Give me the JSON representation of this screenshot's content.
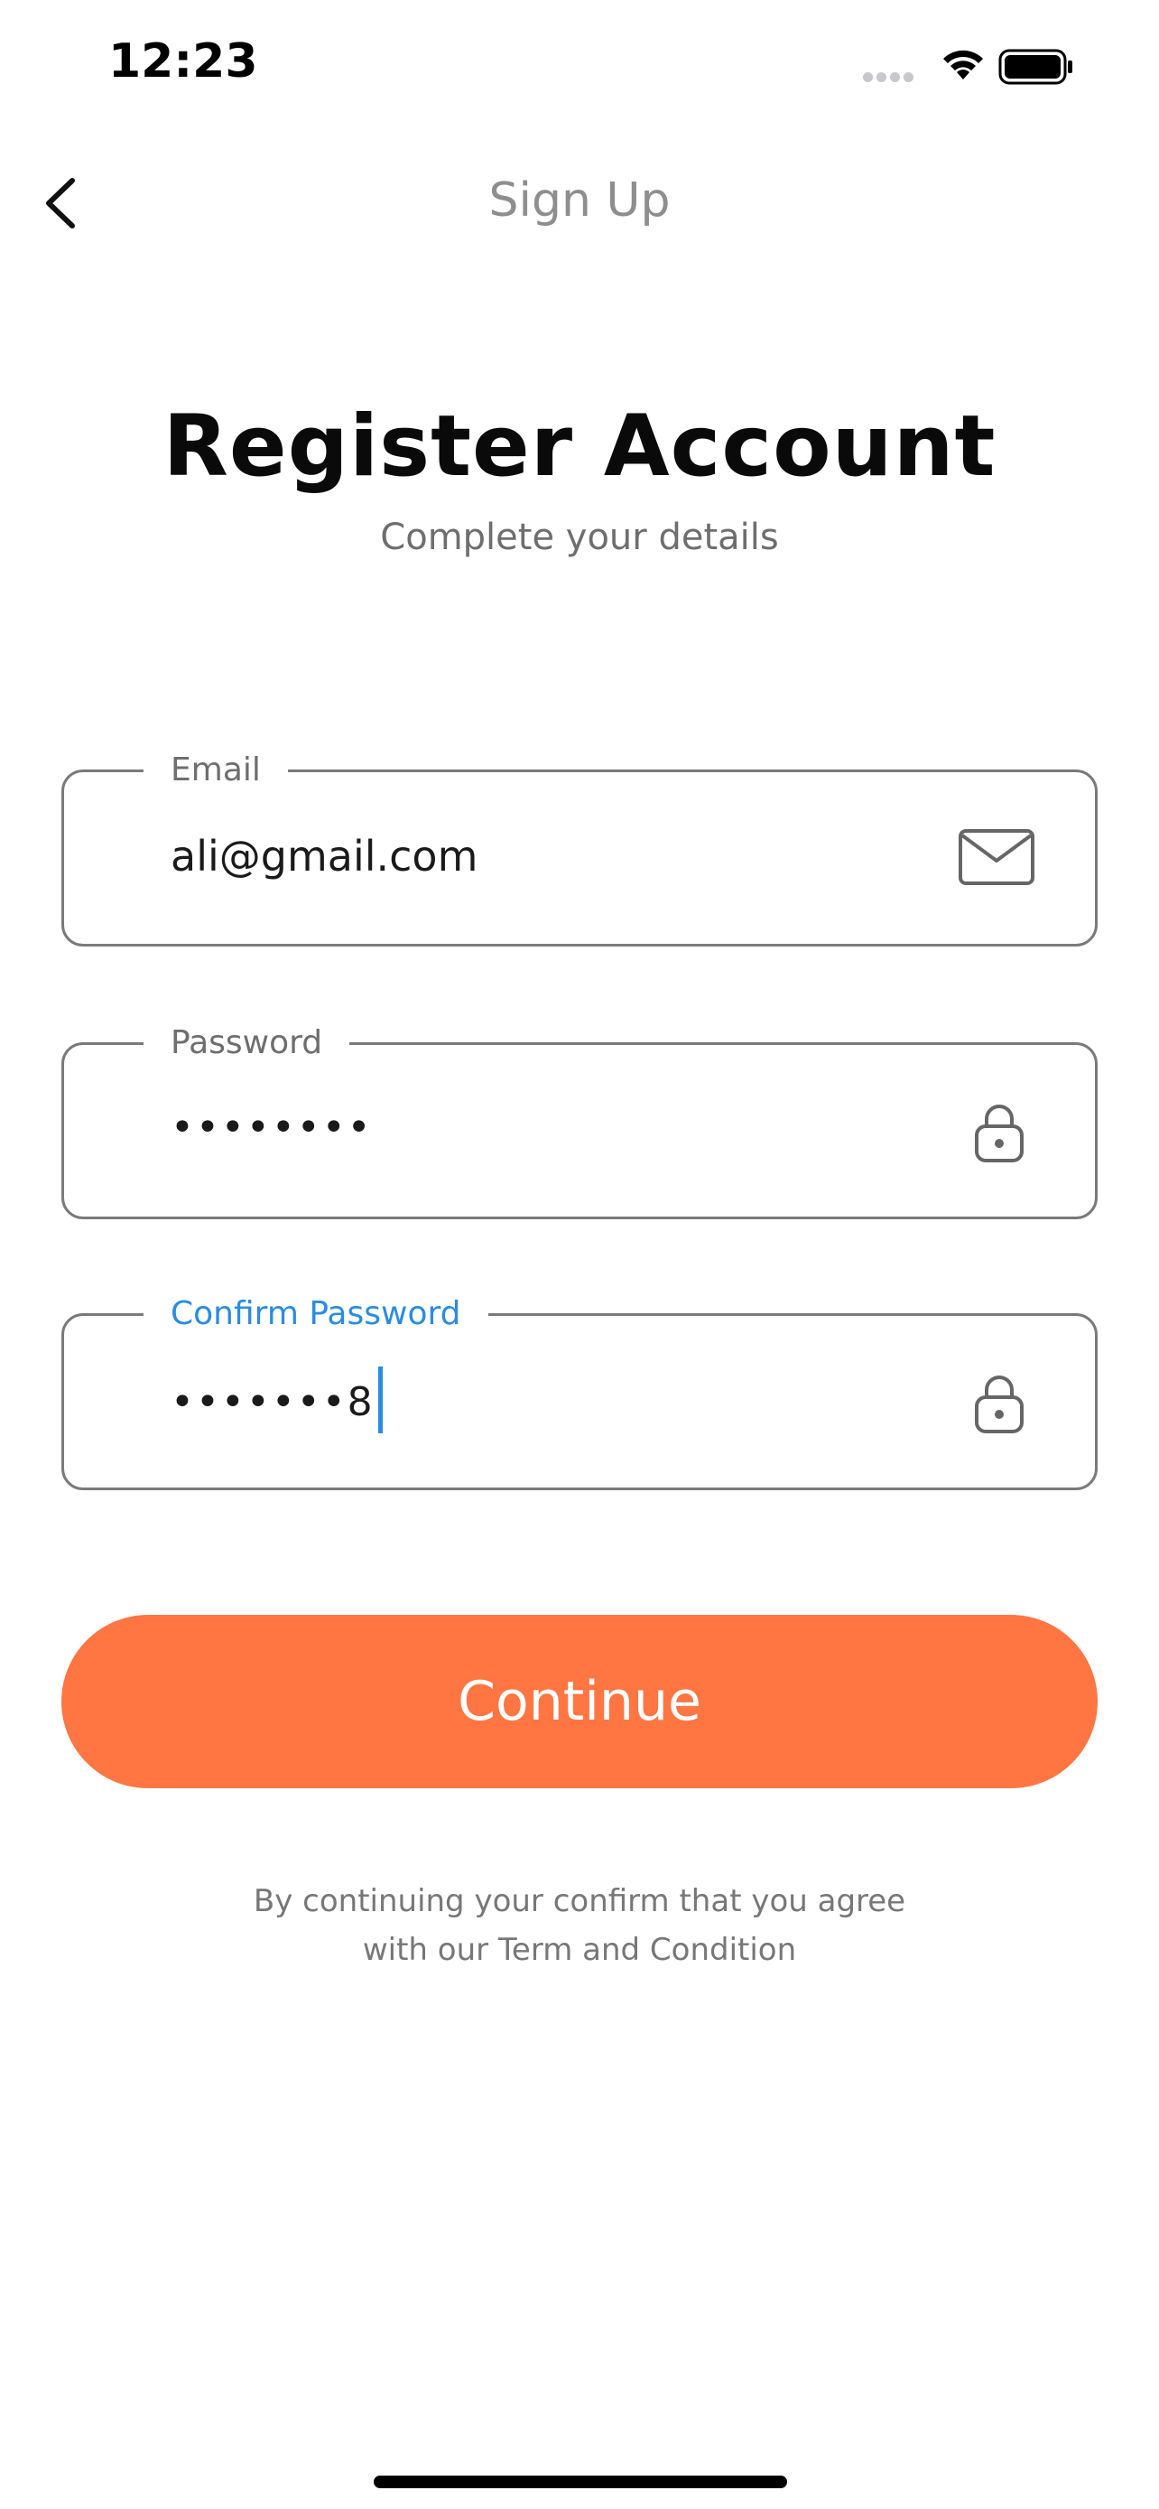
{
  "status_bar": {
    "time": "12:23"
  },
  "nav": {
    "title": "Sign Up"
  },
  "header": {
    "title": "Register Account",
    "subtitle": "Complete your details"
  },
  "form": {
    "email": {
      "label": "Email",
      "value": "ali@gmail.com",
      "icon": "mail-icon"
    },
    "password": {
      "label": "Password",
      "value": "••••••••",
      "icon": "lock-icon"
    },
    "confirm_password": {
      "label": "Confirm Password",
      "value": "•••••••8",
      "icon": "lock-icon",
      "focused": true
    }
  },
  "actions": {
    "continue_label": "Continue"
  },
  "terms": {
    "line1": "By continuing your confirm that you agree",
    "line2": "with our Term and Condition"
  },
  "colors": {
    "accent": "#ff7643",
    "focus": "#2a8ce2",
    "border": "#7a7a7a"
  }
}
